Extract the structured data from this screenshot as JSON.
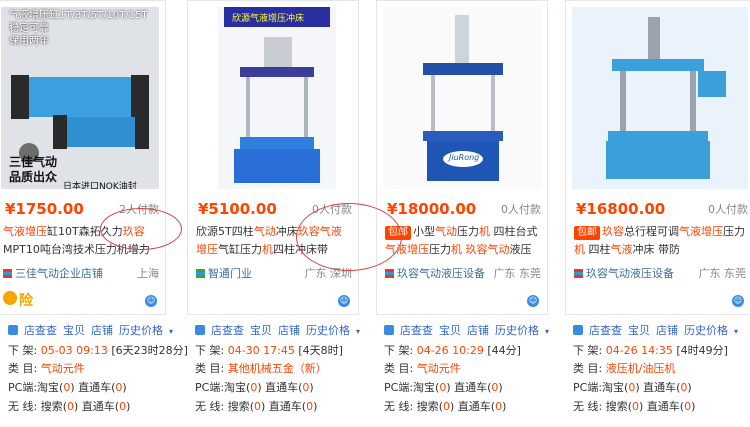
{
  "cards": [
    {
      "price": "¥1750.00",
      "paid": "2人付款",
      "title_parts": [
        {
          "t": "气液增压",
          "c": "hl"
        },
        {
          "t": "缸10T森拓久力",
          "c": ""
        },
        {
          "t": "玖容",
          "c": "hl"
        },
        {
          "t": "MPT10吨台湾技术压力机增力",
          "c": ""
        }
      ],
      "shop": "三佳气动企业店铺",
      "location": "上海",
      "image_text": {
        "top": "气液增压缸1T/3T/5T/10T/15T",
        "top2": "稳定可靠",
        "top3": "保用两年",
        "left": "三佳气动",
        "left2": "品质出众",
        "bottom": "日本进口NOK油封"
      }
    },
    {
      "price": "¥5100.00",
      "paid": "0人付款",
      "title_parts": [
        {
          "t": "欣源5T四柱",
          "c": ""
        },
        {
          "t": "气动",
          "c": "hl"
        },
        {
          "t": "冲床",
          "c": ""
        },
        {
          "t": "玖容",
          "c": "hl"
        },
        {
          "t": "气",
          "c": "hl"
        },
        {
          "t": "液增压",
          "c": "hl"
        },
        {
          "t": "气缸压力",
          "c": ""
        },
        {
          "t": "机",
          "c": "hl"
        },
        {
          "t": "四柱冲床带",
          "c": ""
        }
      ],
      "shop": "智通门业",
      "location": "广东 深圳",
      "image_text": {
        "banner": "欣源气液增压冲床"
      }
    },
    {
      "price": "¥18000.00",
      "paid": "0人付款",
      "tag": "包邮",
      "title_parts": [
        {
          "t": "小型",
          "c": ""
        },
        {
          "t": "气动",
          "c": "hl"
        },
        {
          "t": "压力",
          "c": ""
        },
        {
          "t": "机",
          "c": "hl"
        },
        {
          "t": " 四柱台式",
          "c": ""
        },
        {
          "t": "气液增压",
          "c": "hl"
        },
        {
          "t": "压力",
          "c": ""
        },
        {
          "t": "机",
          "c": "hl"
        },
        {
          "t": " ",
          "c": ""
        },
        {
          "t": "玖容",
          "c": "hl"
        },
        {
          "t": "气动",
          "c": "hl"
        },
        {
          "t": "液压设",
          "c": ""
        }
      ],
      "shop": "玖容气动液压设备",
      "location": "广东 东莞",
      "image_text": {
        "label": "JiuRong"
      }
    },
    {
      "price": "¥16800.00",
      "paid": "0人付款",
      "tag": "包邮",
      "title_parts": [
        {
          "t": "玖容",
          "c": "hl"
        },
        {
          "t": "总行程可调",
          "c": ""
        },
        {
          "t": "气液增",
          "c": "hl"
        },
        {
          "t": "压",
          "c": "hl"
        },
        {
          "t": "压力",
          "c": ""
        },
        {
          "t": "机",
          "c": "hl"
        },
        {
          "t": " 四柱",
          "c": ""
        },
        {
          "t": "气液",
          "c": "hl"
        },
        {
          "t": "冲床 带防",
          "c": ""
        }
      ],
      "shop": "玖容气动液压设备",
      "location": "广东 东莞",
      "image_text": {}
    }
  ],
  "info_panels": [
    {
      "links": [
        "店查查",
        "宝贝",
        "店铺",
        "历史价格"
      ],
      "shelf_label": "下 架:",
      "shelf_date": "05-03 09:13",
      "shelf_remain": "[6天23时28分]",
      "cat_label": "类 目:",
      "category": "气动元件",
      "pc_label": "PC端:",
      "pc_taobao": "淘宝(",
      "pc_taobao_n": "0",
      "pc_through": ") 直通车(",
      "pc_through_n": "0",
      "wireless_label": "无 线:",
      "w_search": "搜索(",
      "w_search_n": "0",
      "w_through": ") 直通车(",
      "w_through_n": "0",
      "close": ")"
    },
    {
      "links": [
        "店查查",
        "宝贝",
        "店铺",
        "历史价格"
      ],
      "shelf_label": "下 架:",
      "shelf_date": "04-30 17:45",
      "shelf_remain": "[4天8时]",
      "cat_label": "类 目:",
      "category": "其他机械五金（新）",
      "pc_label": "PC端:",
      "pc_taobao": "淘宝(",
      "pc_taobao_n": "0",
      "pc_through": ") 直通车(",
      "pc_through_n": "0",
      "wireless_label": "无 线:",
      "w_search": "搜索(",
      "w_search_n": "0",
      "w_through": ") 直通车(",
      "w_through_n": "0",
      "close": ")"
    },
    {
      "links": [
        "店查查",
        "宝贝",
        "店铺",
        "历史价格"
      ],
      "shelf_label": "下 架:",
      "shelf_date": "04-26 10:29",
      "shelf_remain": "[44分]",
      "cat_label": "类 目:",
      "category": "气动元件",
      "pc_label": "PC端:",
      "pc_taobao": "淘宝(",
      "pc_taobao_n": "0",
      "pc_through": ") 直通车(",
      "pc_through_n": "0",
      "wireless_label": "无 线:",
      "w_search": "搜索(",
      "w_search_n": "0",
      "w_through": ") 直通车(",
      "w_through_n": "0",
      "close": ")"
    },
    {
      "links": [
        "店查查",
        "宝贝",
        "店铺",
        "历史价格"
      ],
      "shelf_label": "下 架:",
      "shelf_date": "04-26 14:35",
      "shelf_remain": "[4时49分]",
      "cat_label": "类 目:",
      "category": "液压机/油压机",
      "pc_label": "PC端:",
      "pc_taobao": "淘宝(",
      "pc_taobao_n": "0",
      "pc_through": ") 直通车(",
      "pc_through_n": "0",
      "wireless_label": "无 线:",
      "w_search": "搜索(",
      "w_search_n": "0",
      "w_through": ") 直通车(",
      "w_through_n": "0",
      "close": ")"
    }
  ],
  "first_card_badge": "险",
  "colors": {
    "price": "#ff4400",
    "link": "#3366cc",
    "annotation": "#d94040"
  }
}
